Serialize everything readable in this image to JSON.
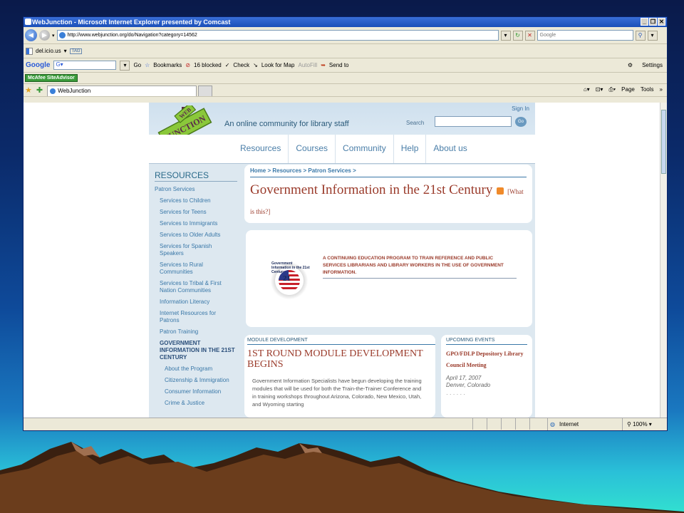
{
  "window": {
    "title": "WebJunction - Microsoft Internet Explorer presented by Comcast"
  },
  "address": {
    "url": "http://www.webjunction.org/do/Navigation?category=14562",
    "search_placeholder": "Google"
  },
  "links_bar": {
    "delicious": "del.icio.us",
    "tag": "TAG"
  },
  "google_bar": {
    "logo": "Google",
    "go": "Go",
    "bookmarks": "Bookmarks",
    "blocked": "16 blocked",
    "check": "Check",
    "look_for_map": "Look for Map",
    "autofill": "AutoFill",
    "send_to": "Send to",
    "settings": "Settings"
  },
  "mcafee": {
    "label": "McAfee SiteAdvisor"
  },
  "tabs": {
    "active": "WebJunction",
    "page": "Page",
    "tools": "Tools"
  },
  "status": {
    "zone": "Internet",
    "zoom": "100%"
  },
  "site": {
    "sign_in": "Sign In",
    "tagline": "An online community for library staff",
    "search_label": "Search",
    "go": "Go",
    "nav": [
      "Resources",
      "Courses",
      "Community",
      "Help",
      "About us"
    ],
    "logo_text": "WEB JUNCTION"
  },
  "sidebar": {
    "title": "RESOURCES",
    "items": [
      "Patron Services",
      "Services to Children",
      "Services for Teens",
      "Services to Immigrants",
      "Services to Older Adults",
      "Services for Spanish Speakers",
      "Services to Rural Communities",
      "Services to Tribal & First Nation Communities",
      "Information Literacy",
      "Internet Resources for Patrons",
      "Patron Training",
      "GOVERNMENT INFORMATION IN THE 21ST CENTURY",
      "About the Program",
      "Citizenship & Immigration",
      "Consumer Information",
      "Crime & Justice"
    ]
  },
  "content": {
    "breadcrumb": "Home > Resources > Patron Services >",
    "title": "Government Information in the 21st Century",
    "what_is_this": "[What is this?]",
    "banner": {
      "seal_text": "Government Information in the 21st Century",
      "seal_center": "21",
      "text": "A CONTINUING EDUCATION PROGRAM TO TRAIN REFERENCE AND PUBLIC SERVICES LIBRARIANS AND LIBRARY WORKERS IN THE USE OF GOVERNMENT INFORMATION."
    },
    "module": {
      "label": "MODULE DEVELOPMENT",
      "heading": "1ST ROUND MODULE DEVELOPMENT BEGINS",
      "body": "Government Information Specialists have begun developing the training modules that will be used for both the Train-the-Trainer Conference and in training workshops throughout Arizona, Colorado, New Mexico, Utah, and Wyoming starting"
    },
    "events": {
      "label": "UPCOMING EVENTS",
      "title": "GPO/FDLP Depository Library Council Meeting",
      "date": "April 17, 2007",
      "location": "Denver, Colorado"
    }
  }
}
